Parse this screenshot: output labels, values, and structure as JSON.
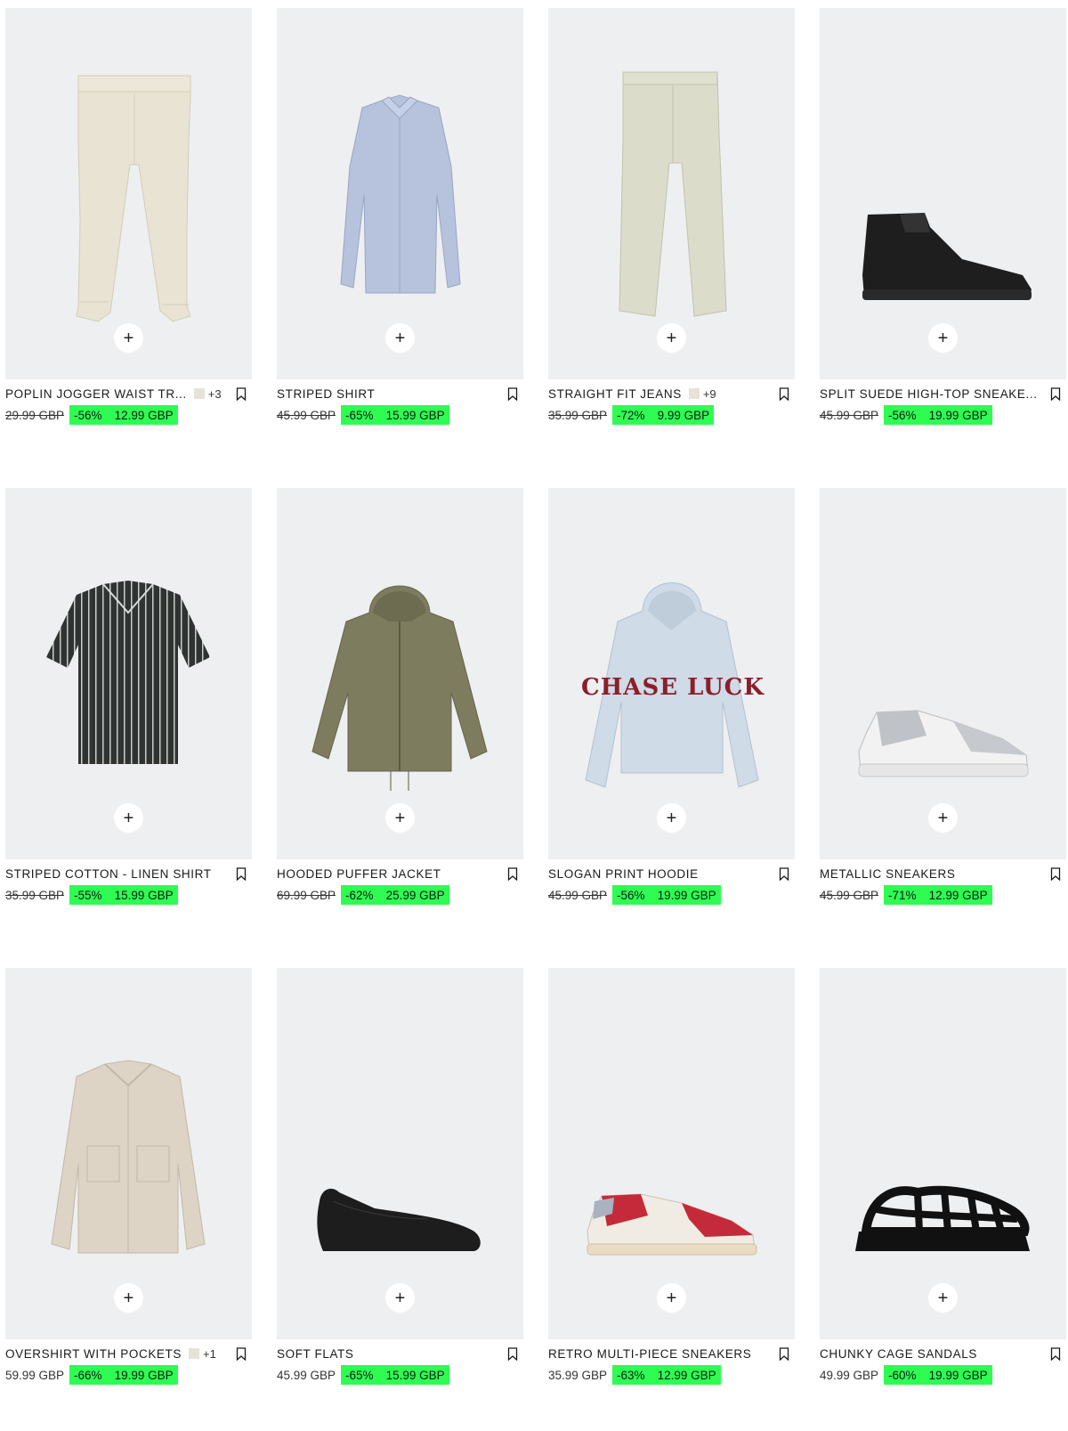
{
  "ui": {
    "add_symbol": "+",
    "icons": {
      "add": "plus-icon",
      "bookmark": "bookmark-icon"
    },
    "colors": {
      "sale_highlight": "#2efc53",
      "card_background": "#eeeff1"
    }
  },
  "products": [
    {
      "name": "POPLIN JOGGER WAIST TROUSERS",
      "name_display": "POPLIN JOGGER WAIST TR...",
      "more_colors": "+3",
      "old_price": "29.99 GBP",
      "discount": "-56%",
      "price": "12.99 GBP"
    },
    {
      "name": "STRIPED SHIRT",
      "name_display": "STRIPED SHIRT",
      "more_colors": "",
      "old_price": "45.99 GBP",
      "discount": "-65%",
      "price": "15.99 GBP"
    },
    {
      "name": "STRAIGHT FIT JEANS",
      "name_display": "STRAIGHT FIT JEANS",
      "more_colors": "+9",
      "old_price": "35.99 GBP",
      "discount": "-72%",
      "price": "9.99 GBP"
    },
    {
      "name": "SPLIT SUEDE HIGH-TOP SNEAKERS",
      "name_display": "SPLIT SUEDE HIGH-TOP SNEAKE...",
      "more_colors": "",
      "old_price": "45.99 GBP",
      "discount": "-56%",
      "price": "19.99 GBP"
    },
    {
      "name": "STRIPED COTTON - LINEN SHIRT",
      "name_display": "STRIPED COTTON - LINEN SHIRT",
      "more_colors": "",
      "old_price": "35.99 GBP",
      "discount": "-55%",
      "price": "15.99 GBP"
    },
    {
      "name": "HOODED PUFFER JACKET",
      "name_display": "HOODED PUFFER JACKET",
      "more_colors": "",
      "old_price": "69.99 GBP",
      "discount": "-62%",
      "price": "25.99 GBP"
    },
    {
      "name": "SLOGAN PRINT HOODIE",
      "name_display": "SLOGAN PRINT HOODIE",
      "more_colors": "",
      "old_price": "45.99 GBP",
      "discount": "-56%",
      "price": "19.99 GBP",
      "print_text": "CHASE LUCK"
    },
    {
      "name": "METALLIC SNEAKERS",
      "name_display": "METALLIC SNEAKERS",
      "more_colors": "",
      "old_price": "45.99 GBP",
      "discount": "-71%",
      "price": "12.99 GBP"
    },
    {
      "name": "OVERSHIRT WITH POCKETS",
      "name_display": "OVERSHIRT WITH POCKETS",
      "more_colors": "+1",
      "old_price": "59.99 GBP",
      "discount": "-66%",
      "price": "19.99 GBP"
    },
    {
      "name": "SOFT FLATS",
      "name_display": "SOFT FLATS",
      "more_colors": "",
      "old_price": "45.99 GBP",
      "discount": "-65%",
      "price": "15.99 GBP"
    },
    {
      "name": "RETRO MULTI-PIECE SNEAKERS",
      "name_display": "RETRO MULTI-PIECE SNEAKERS",
      "more_colors": "",
      "old_price": "35.99 GBP",
      "discount": "-63%",
      "price": "12.99 GBP"
    },
    {
      "name": "CHUNKY CAGE SANDALS",
      "name_display": "CHUNKY CAGE SANDALS",
      "more_colors": "",
      "old_price": "49.99 GBP",
      "discount": "-60%",
      "price": "19.99 GBP"
    }
  ]
}
